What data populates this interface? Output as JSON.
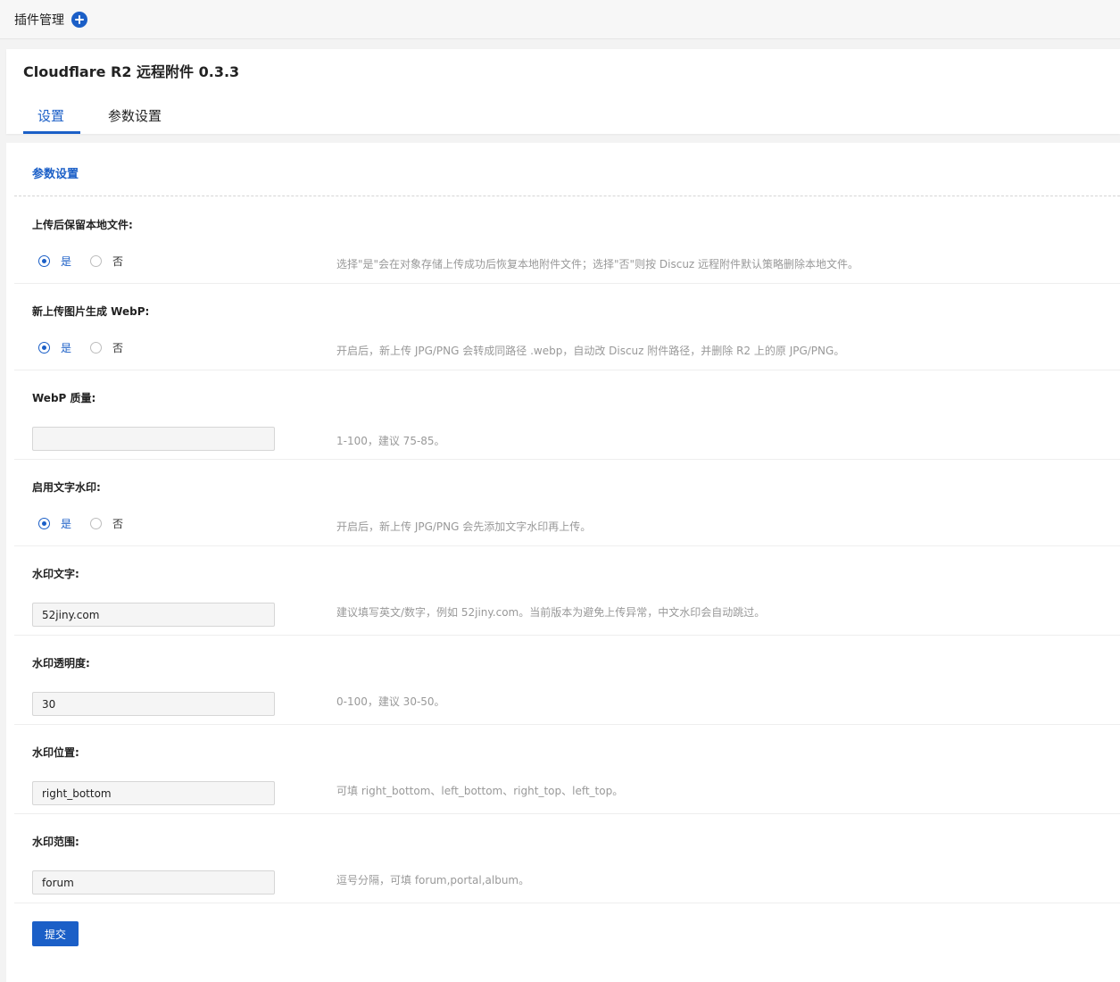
{
  "topbar": {
    "title": "插件管理"
  },
  "header": {
    "title": "Cloudflare R2 远程附件 0.3.3",
    "tabs": [
      {
        "label": "设置",
        "active": true
      },
      {
        "label": "参数设置",
        "active": false
      }
    ]
  },
  "section": {
    "title": "参数设置"
  },
  "fields": {
    "keep_local": {
      "label": "上传后保留本地文件:",
      "yes": "是",
      "no": "否",
      "selected": "是",
      "help": "选择\"是\"会在对象存储上传成功后恢复本地附件文件；选择\"否\"则按 Discuz 远程附件默认策略删除本地文件。"
    },
    "webp": {
      "label": "新上传图片生成 WebP:",
      "yes": "是",
      "no": "否",
      "selected": "是",
      "help": "开启后，新上传 JPG/PNG 会转成同路径 .webp，自动改 Discuz 附件路径，并删除 R2 上的原 JPG/PNG。"
    },
    "webp_quality": {
      "label": "WebP 质量:",
      "value": "",
      "help": "1-100，建议 75-85。"
    },
    "text_watermark": {
      "label": "启用文字水印:",
      "yes": "是",
      "no": "否",
      "selected": "是",
      "help": "开启后，新上传 JPG/PNG 会先添加文字水印再上传。"
    },
    "watermark_text": {
      "label": "水印文字:",
      "value": "52jiny.com",
      "help": "建议填写英文/数字，例如 52jiny.com。当前版本为避免上传异常，中文水印会自动跳过。"
    },
    "watermark_opacity": {
      "label": "水印透明度:",
      "value": "30",
      "help": "0-100，建议 30-50。"
    },
    "watermark_position": {
      "label": "水印位置:",
      "value": "right_bottom",
      "help": "可填 right_bottom、left_bottom、right_top、left_top。"
    },
    "watermark_scope": {
      "label": "水印范围:",
      "value": "forum",
      "help": "逗号分隔，可填 forum,portal,album。"
    }
  },
  "submit": {
    "label": "提交"
  },
  "colors": {
    "accent": "#1b5fc7",
    "help_text": "#999999"
  },
  "icons": {
    "add": "plus-circle-icon"
  }
}
